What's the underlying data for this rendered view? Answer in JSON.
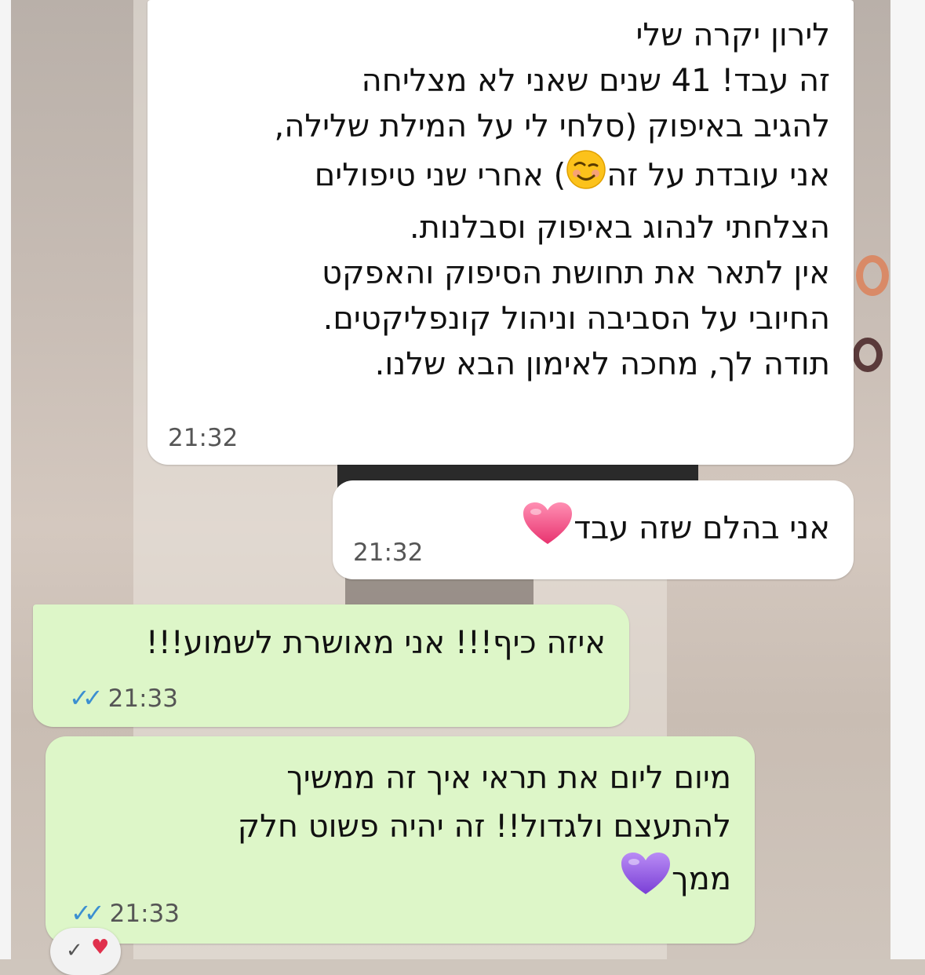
{
  "messages": [
    {
      "direction": "incoming",
      "lines": [
        "לירון יקרה שלי",
        "זה עבד!  41 שנים שאני לא מצליחה",
        "להגיב באיפוק (סלחי לי על המילת שלילה,",
        "אני עובדת על זה",
        "הצלחתי לנהוג באיפוק וסבלנות.",
        "אין לתאר את תחושת הסיפוק והאפקט",
        "החיובי על הסביבה וניהול קונפליקטים.",
        "תודה לך, מחכה לאימון הבא שלנו."
      ],
      "line4_after_emoji": ") אחרי שני טיפולים",
      "emoji": "smiling-face-icon",
      "time": "21:32"
    },
    {
      "direction": "incoming",
      "text": "אני בהלם שזה עבד",
      "emoji": "pink-heart-icon",
      "time": "21:32"
    },
    {
      "direction": "outgoing",
      "text": "איזה כיף!!! אני מאושרת לשמוע!!!",
      "time": "21:33",
      "status": "read"
    },
    {
      "direction": "outgoing",
      "lines": [
        "מיום ליום את תראי איך זה ממשיך",
        "להתעצם ולגדול!! זה יהיה פשוט חלק",
        "ממך"
      ],
      "emoji": "purple-heart-icon",
      "time": "21:33",
      "status": "read"
    }
  ],
  "colors": {
    "incoming_bubble": "#ffffff",
    "outgoing_bubble": "#ddf6c8",
    "read_ticks": "#3b8fd1"
  }
}
